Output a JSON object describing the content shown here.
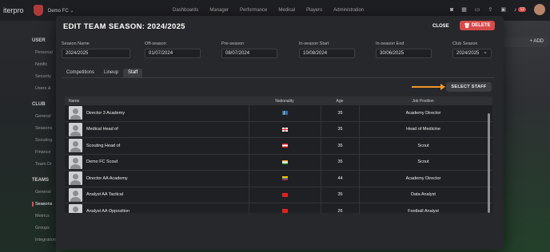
{
  "app": {
    "logo": "iterpro",
    "club_selector": "Demo FC",
    "nav": [
      "Dashboards",
      "Manager",
      "Performance",
      "Medical",
      "Players",
      "Administration"
    ],
    "notification_count": "12"
  },
  "sidebar": {
    "sections": [
      {
        "title": "USER",
        "items": [
          "Personal",
          "Notific",
          "Security",
          "Users &"
        ]
      },
      {
        "title": "CLUB",
        "items": [
          "General",
          "Seasons",
          "Scouting",
          "Finance",
          "Team Dr"
        ]
      },
      {
        "title": "TEAMS",
        "items": [
          "General",
          "Seasons",
          "Metrics",
          "Groups",
          "Integrations"
        ]
      }
    ],
    "active_item": "Seasons"
  },
  "background": {
    "add_label": "ADD"
  },
  "modal": {
    "title": "EDIT TEAM SEASON: 2024/2025",
    "close_label": "CLOSE",
    "delete_label": "DELETE",
    "fields": [
      {
        "label": "Season Name",
        "value": "2024/2025"
      },
      {
        "label": "Off-season",
        "value": "01/07/2024"
      },
      {
        "label": "Pre-season",
        "value": "08/07/2024"
      },
      {
        "label": "In-season Start",
        "value": "10/08/2024"
      },
      {
        "label": "In-season End",
        "value": "30/06/2025"
      },
      {
        "label": "Club Season",
        "value": "2024/2025"
      }
    ],
    "tabs": [
      "Competitions",
      "Lineup",
      "Staff"
    ],
    "active_tab": "Staff",
    "select_staff_label": "SELECT STAFF",
    "table": {
      "headers": [
        "Name",
        "Nationality",
        "Age",
        "Job Position"
      ],
      "rows": [
        {
          "name": "Director 3 Academy",
          "flag": "sweden",
          "age": "35",
          "position": "Academy Director"
        },
        {
          "name": "Medical Head of",
          "flag": "england",
          "age": "35",
          "position": "Head of Medicine"
        },
        {
          "name": "Scouting Head of",
          "flag": "austria",
          "age": "35",
          "position": "Scout"
        },
        {
          "name": "Demo FC Scout",
          "flag": "india",
          "age": "35",
          "position": "Scout"
        },
        {
          "name": "Director AA Academy",
          "flag": "colombia",
          "age": "44",
          "position": "Academy Director"
        },
        {
          "name": "Analyst AA Tactical",
          "flag": "turkey",
          "age": "35",
          "position": "Data Analyst"
        },
        {
          "name": "Analyst AA Opposition",
          "flag": "turkey",
          "age": "26",
          "position": "Football Analyst"
        }
      ]
    }
  },
  "colors": {
    "accent": "#d84a4a",
    "arrow": "#f0962a"
  }
}
